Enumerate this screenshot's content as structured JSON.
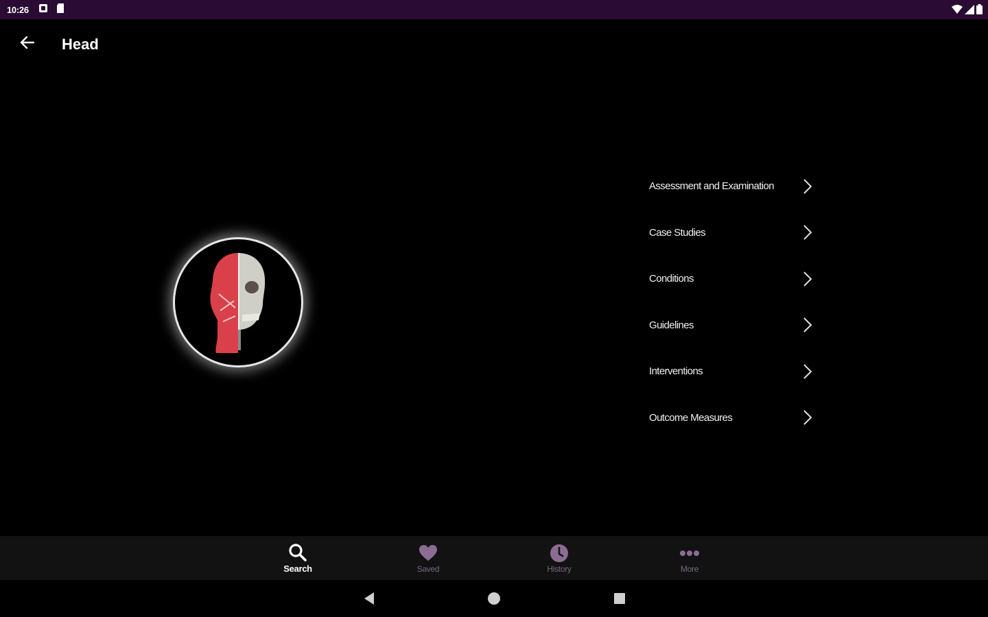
{
  "status_bar": {
    "time": "10:26",
    "left_icons": [
      "notification-icon",
      "sd-card-icon"
    ],
    "right_icons": [
      "wifi-icon",
      "signal-icon",
      "battery-icon"
    ],
    "background": "#2a0b33"
  },
  "app_bar": {
    "title": "Head",
    "back_icon": "arrow-back-icon"
  },
  "hero": {
    "image_icon": "head-anatomy-image"
  },
  "menu": {
    "items": [
      {
        "label": "Assessment and Examination",
        "icon": "chevron-right-icon"
      },
      {
        "label": "Case Studies",
        "icon": "chevron-right-icon"
      },
      {
        "label": "Conditions",
        "icon": "chevron-right-icon"
      },
      {
        "label": "Guidelines",
        "icon": "chevron-right-icon"
      },
      {
        "label": "Interventions",
        "icon": "chevron-right-icon"
      },
      {
        "label": "Outcome Measures",
        "icon": "chevron-right-icon"
      }
    ]
  },
  "bottom_nav": {
    "items": [
      {
        "label": "Search",
        "icon": "search-icon",
        "active": true
      },
      {
        "label": "Saved",
        "icon": "heart-icon",
        "active": false
      },
      {
        "label": "History",
        "icon": "clock-icon",
        "active": false
      },
      {
        "label": "More",
        "icon": "more-dots-icon",
        "active": false
      }
    ],
    "active_color": "#ffffff",
    "inactive_color": "#7a6a80"
  },
  "system_nav": {
    "icons": [
      "back-triangle-icon",
      "home-circle-icon",
      "recents-square-icon"
    ]
  }
}
